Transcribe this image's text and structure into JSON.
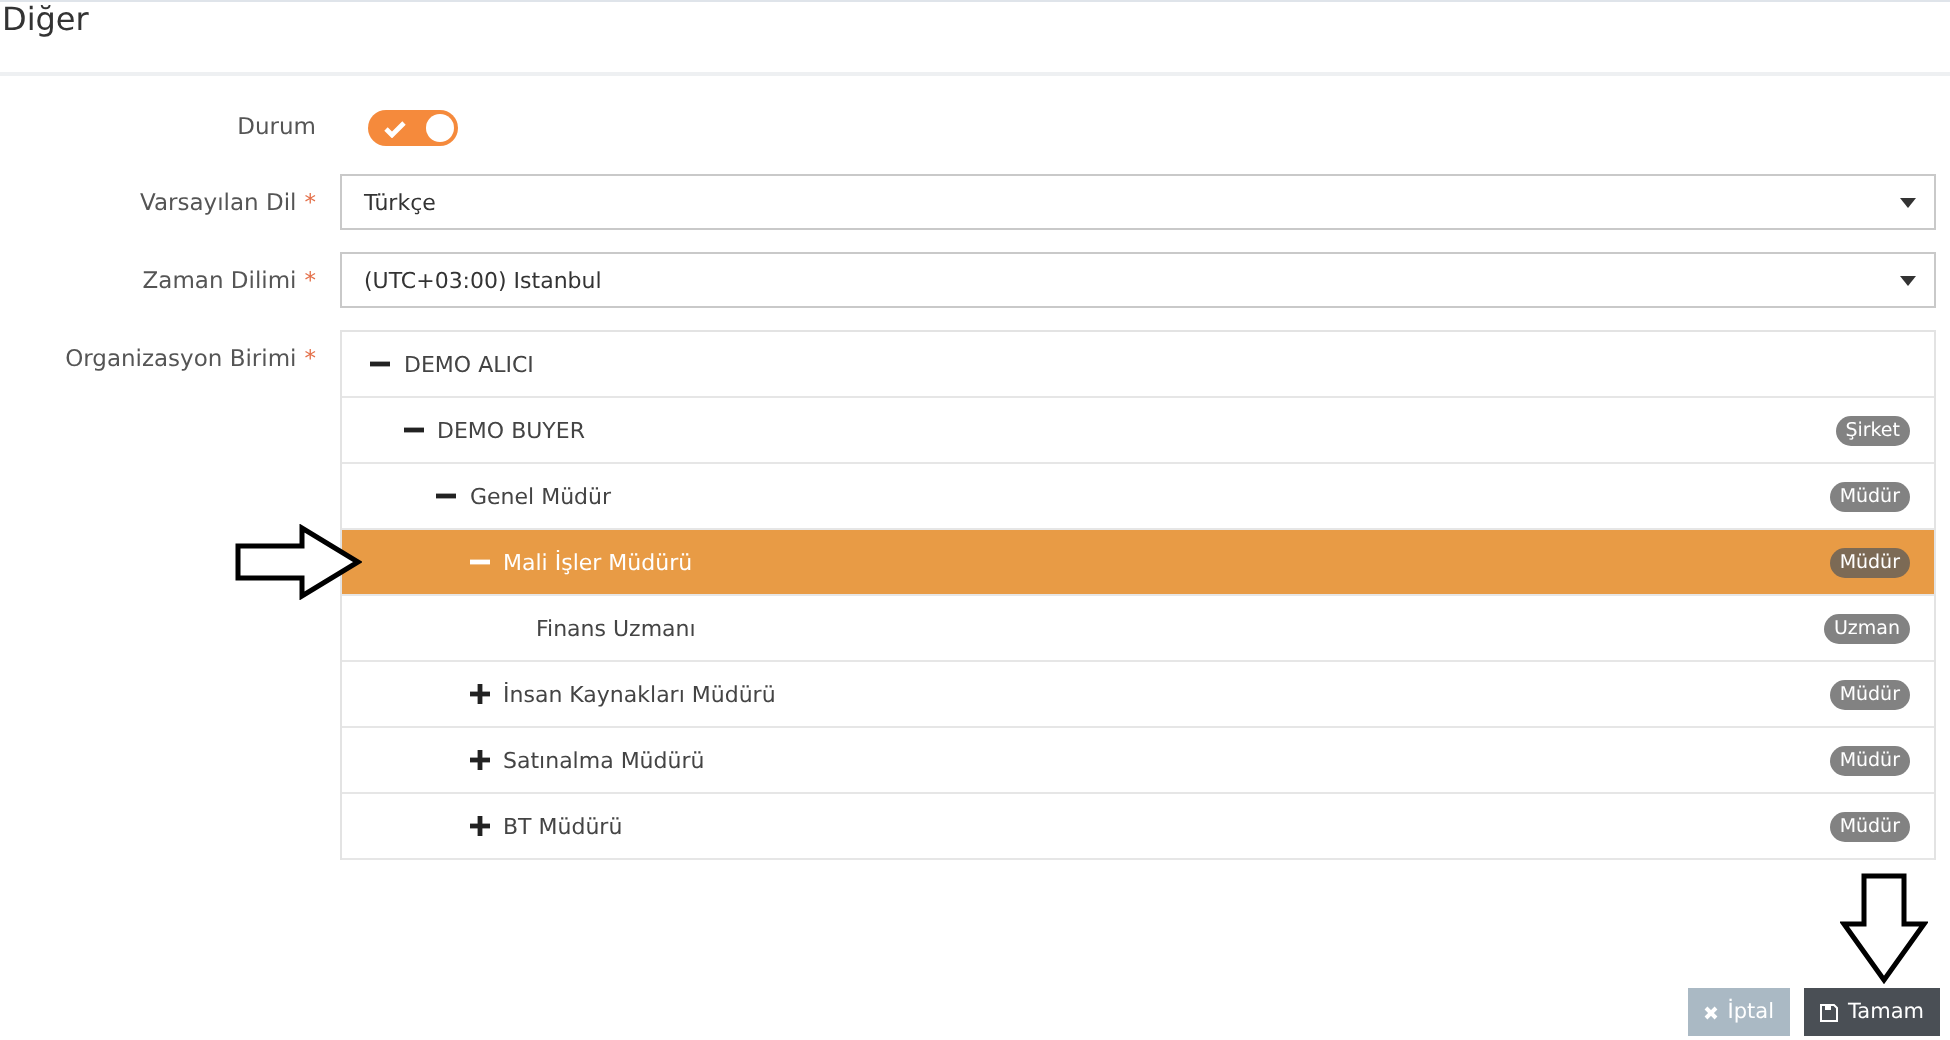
{
  "title": "Diğer",
  "status": {
    "label": "Durum",
    "on": true
  },
  "fields": [
    {
      "label": "Varsayılan Dil",
      "required_mark": "*",
      "value": "Türkçe"
    },
    {
      "label": "Zaman Dilimi",
      "required_mark": "*",
      "value": "(UTC+03:00) Istanbul"
    }
  ],
  "org_unit": {
    "label": "Organizasyon Birimi",
    "required_mark": "*",
    "tree": [
      {
        "name": "DEMO ALICI",
        "expanded": true,
        "selected": false,
        "children": [
          {
            "name": "DEMO BUYER",
            "badge": "Şirket",
            "expanded": true,
            "selected": false,
            "children": [
              {
                "name": "Genel Müdür",
                "badge": "Müdür",
                "expanded": true,
                "selected": false,
                "children": [
                  {
                    "name": "Mali İşler Müdürü",
                    "badge": "Müdür",
                    "expanded": true,
                    "selected": true,
                    "children": [
                      {
                        "name": "Finans Uzmanı",
                        "badge": "Uzman",
                        "selected": false
                      }
                    ]
                  },
                  {
                    "name": "İnsan Kaynakları Müdürü",
                    "badge": "Müdür",
                    "expanded": false,
                    "selected": false
                  },
                  {
                    "name": "Satınalma Müdürü",
                    "badge": "Müdür",
                    "expanded": false,
                    "selected": false
                  },
                  {
                    "name": "BT Müdürü",
                    "badge": "Müdür",
                    "expanded": false,
                    "selected": false
                  }
                ]
              }
            ]
          }
        ]
      }
    ]
  },
  "buttons": [
    {
      "kind": "cancel",
      "label": "İptal"
    },
    {
      "kind": "save",
      "label": "Tamam"
    }
  ]
}
